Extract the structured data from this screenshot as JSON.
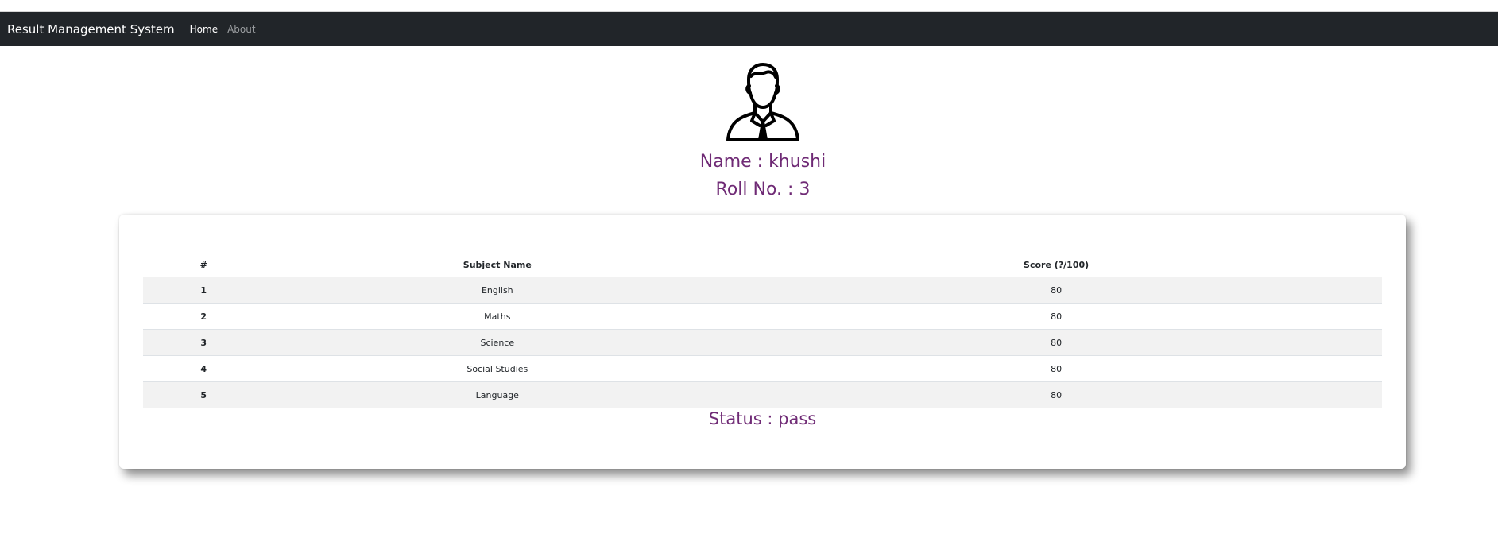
{
  "navbar": {
    "brand": "Result Management System",
    "links": [
      {
        "label": "Home",
        "active": true
      },
      {
        "label": "About",
        "active": false
      }
    ]
  },
  "profile": {
    "name_line": "Name : khushi",
    "roll_line": "Roll No. : 3",
    "avatar_icon": "person-icon"
  },
  "results": {
    "headers": [
      "#",
      "Subject Name",
      "Score (?/100)"
    ],
    "rows": [
      [
        "1",
        "English",
        "80"
      ],
      [
        "2",
        "Maths",
        "80"
      ],
      [
        "3",
        "Science",
        "80"
      ],
      [
        "4",
        "Social Studies",
        "80"
      ],
      [
        "5",
        "Language",
        "80"
      ]
    ]
  },
  "status_line": "Status : pass",
  "colors": {
    "navbar_bg": "#212529",
    "accent_text": "#6f2a75",
    "stripe": "#f2f2f2"
  }
}
